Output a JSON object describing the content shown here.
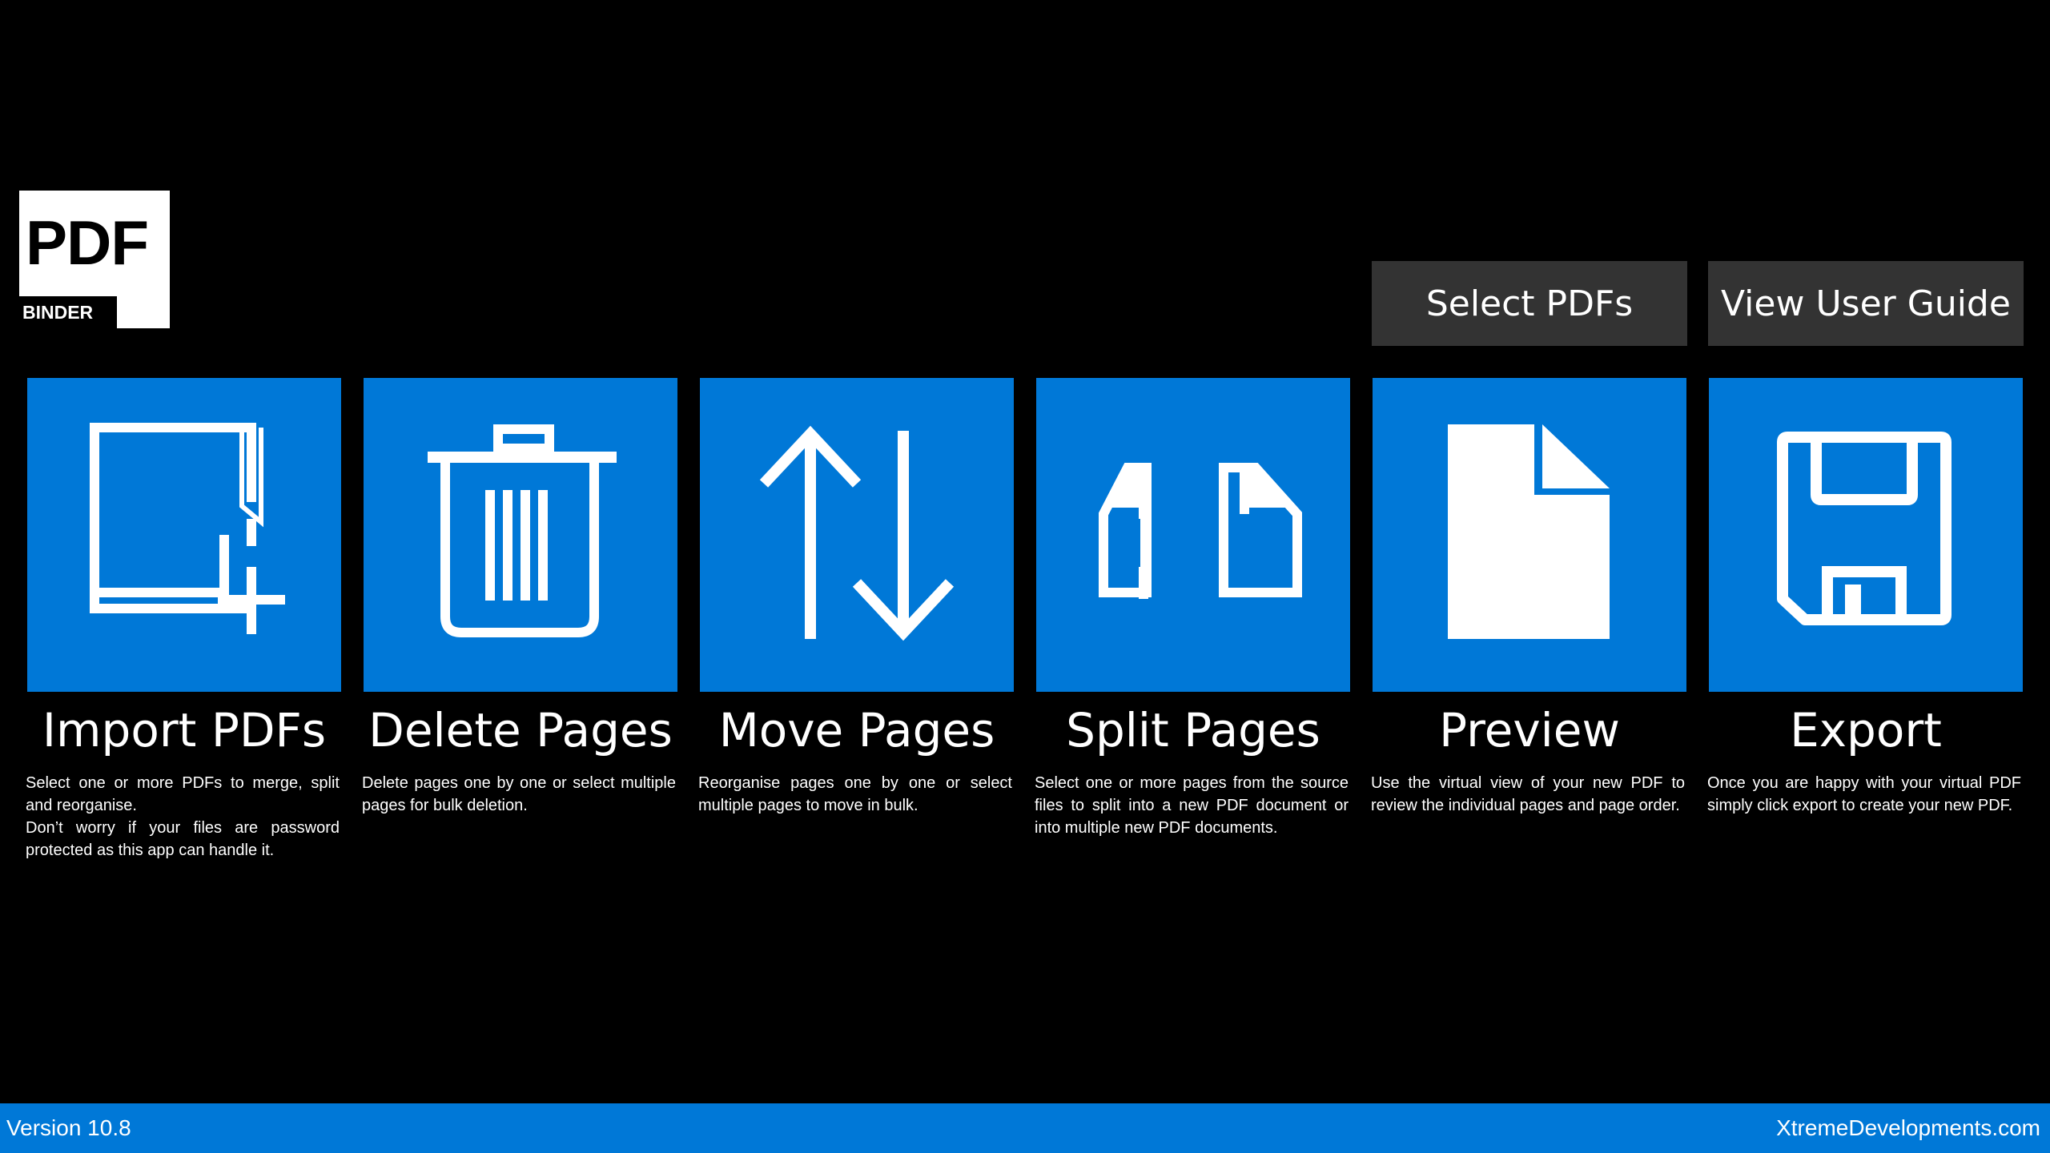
{
  "logo": {
    "main_text": "PDF",
    "band_text": "BINDER"
  },
  "buttons": {
    "select_pdfs": "Select PDFs",
    "view_user_guide": "View User Guide"
  },
  "tiles": [
    {
      "title": "Import PDFs",
      "icon": "import-document-icon",
      "description": [
        "Select one or more PDFs to merge, split and reorganise.",
        "Don’t worry if your files are password protected as this app can handle it."
      ]
    },
    {
      "title": "Delete Pages",
      "icon": "trash-icon",
      "description": [
        "Delete pages one by one or select multiple pages for bulk deletion."
      ]
    },
    {
      "title": "Move Pages",
      "icon": "up-down-arrows-icon",
      "description": [
        "Reorganise pages one by one or select multiple pages to move in bulk."
      ]
    },
    {
      "title": "Split Pages",
      "icon": "split-pages-icon",
      "description": [
        "Select one or more pages from the source files to split into a new PDF document  or into multiple new PDF documents."
      ]
    },
    {
      "title": "Preview",
      "icon": "page-icon",
      "description": [
        "Use the virtual view of your new PDF to review the individual pages and page order."
      ]
    },
    {
      "title": "Export",
      "icon": "floppy-disk-icon",
      "description": [
        "Once you are happy with your virtual PDF simply click export to create your new PDF."
      ]
    }
  ],
  "statusbar": {
    "version": "Version 10.8",
    "company": "XtremeDevelopments.com"
  },
  "colors": {
    "accent": "#0078d7",
    "button_bg": "#333333",
    "background": "#000000"
  }
}
